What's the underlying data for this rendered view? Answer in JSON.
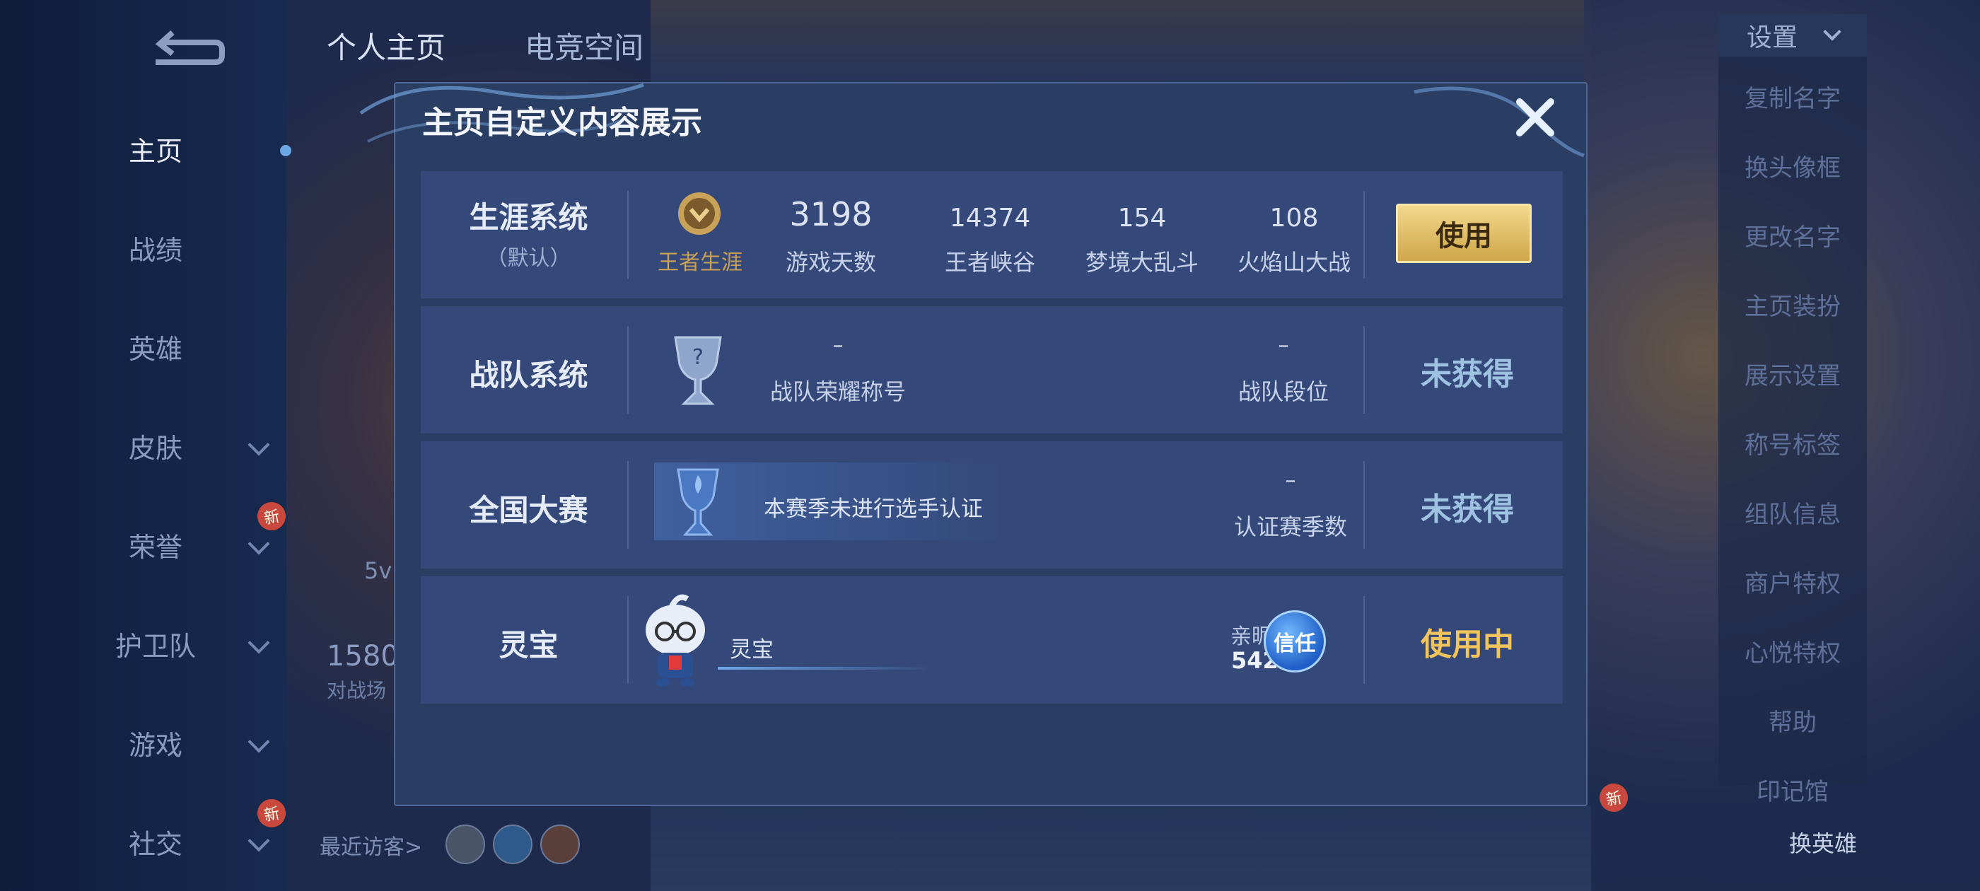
{
  "top_tabs": [
    "个人主页",
    "电竞空间"
  ],
  "left_nav": {
    "items": [
      {
        "label": "主页"
      },
      {
        "label": "战绩"
      },
      {
        "label": "英雄"
      },
      {
        "label": "皮肤"
      },
      {
        "label": "荣誉"
      },
      {
        "label": "护卫队"
      },
      {
        "label": "游戏"
      },
      {
        "label": "社交"
      }
    ],
    "new_badge": "新"
  },
  "background": {
    "recent_visitors": "最近访客>",
    "score_partial": "1580",
    "score_sub_partial": "对战场",
    "mode_partial": "5v"
  },
  "right_menu": {
    "header": "设置",
    "items": [
      "复制名字",
      "换头像框",
      "更改名字",
      "主页装扮",
      "展示设置",
      "称号标签",
      "组队信息",
      "商户特权",
      "心悦特权",
      "帮助",
      "印记馆"
    ],
    "switch_hero": "换英雄",
    "new_badge": "新"
  },
  "dialog": {
    "title": "主页自定义内容展示",
    "rows": {
      "career": {
        "title": "生涯系统",
        "subtitle": "（默认）",
        "emblem_label": "王者生涯",
        "stats": [
          {
            "value": "3198",
            "label": "游戏天数"
          },
          {
            "value": "14374",
            "label": "王者峡谷"
          },
          {
            "value": "154",
            "label": "梦境大乱斗"
          },
          {
            "value": "108",
            "label": "火焰山大战"
          }
        ],
        "action": "使用"
      },
      "team": {
        "title": "战队系统",
        "honor_value": "–",
        "honor_label": "战队荣耀称号",
        "rank_value": "–",
        "rank_label": "战队段位",
        "status": "未获得"
      },
      "national": {
        "title": "全国大赛",
        "cert_text": "本赛季未进行选手认证",
        "season_value": "–",
        "season_label": "认证赛季数",
        "status": "未获得"
      },
      "lingbao": {
        "title": "灵宝",
        "name": "灵宝",
        "intimacy_label": "亲昵度",
        "intimacy_value": "5424",
        "trust_badge": "信任",
        "status": "使用中"
      }
    }
  },
  "colors": {
    "gold": "#f2c55c",
    "muted_blue": "#9fc2e2",
    "panel": "#2a3d63",
    "row": "#34497a"
  }
}
